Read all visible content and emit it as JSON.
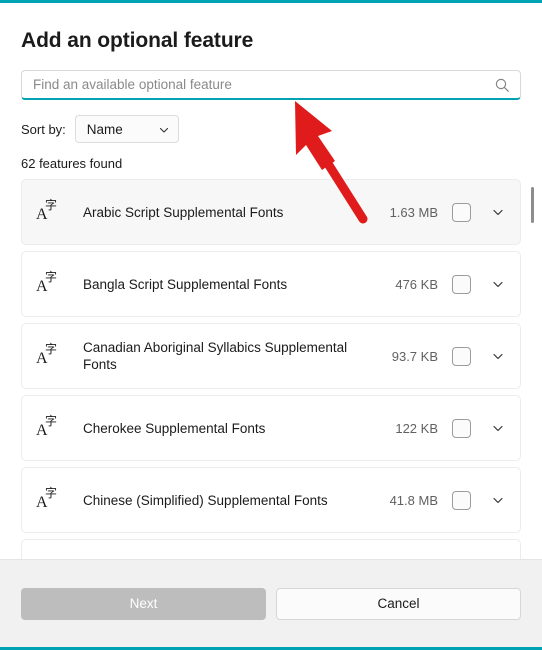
{
  "dialog": {
    "title": "Add an optional feature",
    "accent_color": "#00a2b3"
  },
  "search": {
    "placeholder": "Find an available optional feature",
    "value": "",
    "icon": "search-icon"
  },
  "sort": {
    "label": "Sort by:",
    "value": "Name",
    "options": [
      "Name"
    ],
    "icon": "chevron-down-icon"
  },
  "results": {
    "count_text": "62 features found"
  },
  "features": [
    {
      "icon": "font-icon",
      "name": "Arabic Script Supplemental Fonts",
      "size": "1.63 MB",
      "checked": false,
      "expand_icon": "chevron-down-icon"
    },
    {
      "icon": "font-icon",
      "name": "Bangla Script Supplemental Fonts",
      "size": "476 KB",
      "checked": false,
      "expand_icon": "chevron-down-icon"
    },
    {
      "icon": "font-icon",
      "name": "Canadian Aboriginal Syllabics Supplemental Fonts",
      "size": "93.7 KB",
      "checked": false,
      "expand_icon": "chevron-down-icon"
    },
    {
      "icon": "font-icon",
      "name": "Cherokee Supplemental Fonts",
      "size": "122 KB",
      "checked": false,
      "expand_icon": "chevron-down-icon"
    },
    {
      "icon": "font-icon",
      "name": "Chinese (Simplified) Supplemental Fonts",
      "size": "41.8 MB",
      "checked": false,
      "expand_icon": "chevron-down-icon"
    }
  ],
  "footer": {
    "next_label": "Next",
    "next_disabled": true,
    "cancel_label": "Cancel"
  },
  "annotation": {
    "pointer_color": "#e01b1b",
    "pointer_name": "red-arrow-pointer"
  }
}
